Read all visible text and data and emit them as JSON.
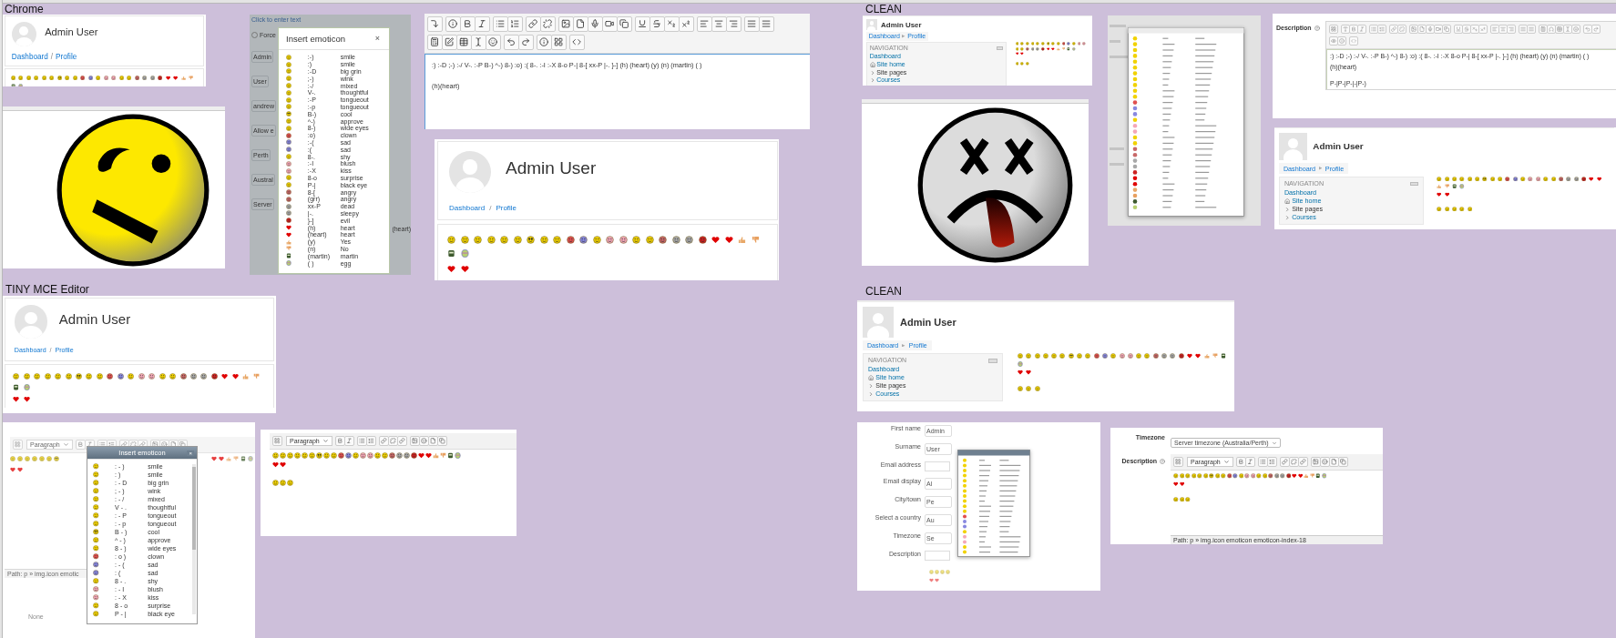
{
  "sections": [
    {
      "label": "Chrome"
    },
    {
      "label": "CLEAN"
    },
    {
      "label": "TINY MCE Editor"
    },
    {
      "label": "CLEAN"
    }
  ],
  "chrome_profile_small": {
    "name": "Admin User",
    "crumbs": [
      "Dashboard",
      "Profile"
    ],
    "separator": "/"
  },
  "chrome_dialog_screen": {
    "link": "Click to enter text",
    "fields": [
      {
        "label": "Force",
        "kind": "radio",
        "checked": false
      },
      {
        "label": "Admin",
        "kind": "field"
      },
      {
        "label": "User",
        "kind": "field"
      },
      {
        "label": "andrew",
        "kind": "field"
      },
      {
        "label": "Allow e",
        "kind": "field"
      },
      {
        "label": "Perth",
        "kind": "field"
      },
      {
        "label": "Austral",
        "kind": "field"
      },
      {
        "label": "Server",
        "kind": "field"
      }
    ],
    "editor_tail": "(heart)",
    "dialog": {
      "kind": "atto",
      "title": "Insert emoticon",
      "close": "×",
      "rows": [
        {
          "code": ":-)",
          "name": "smile"
        },
        {
          "code": ":)",
          "name": "smile"
        },
        {
          "code": ":-D",
          "name": "big grin"
        },
        {
          "code": ";-)",
          "name": "wink"
        },
        {
          "code": ":-/",
          "name": "mixed"
        },
        {
          "code": "V-.",
          "name": "thoughtful"
        },
        {
          "code": ":-P",
          "name": "tongueout"
        },
        {
          "code": ":-p",
          "name": "tongueout"
        },
        {
          "code": "B-)",
          "name": "cool"
        },
        {
          "code": "^-)",
          "name": "approve"
        },
        {
          "code": "8-)",
          "name": "wide eyes"
        },
        {
          "code": ":o)",
          "name": "clown"
        },
        {
          "code": ":-(",
          "name": "sad"
        },
        {
          "code": ":(",
          "name": "sad"
        },
        {
          "code": "8-.",
          "name": "shy"
        },
        {
          "code": ":-I",
          "name": "blush"
        },
        {
          "code": ":-X",
          "name": "kiss"
        },
        {
          "code": "8-o",
          "name": "surprise"
        },
        {
          "code": "P-|",
          "name": "black eye"
        },
        {
          "code": "8-[",
          "name": "angry"
        },
        {
          "code": "(grr)",
          "name": "angry"
        },
        {
          "code": "xx-P",
          "name": "dead"
        },
        {
          "code": "|-.",
          "name": "sleepy"
        },
        {
          "code": "}-]",
          "name": "evil"
        },
        {
          "code": "(h)",
          "name": "heart"
        },
        {
          "code": "(heart)",
          "name": "heart"
        },
        {
          "code": "(y)",
          "name": "Yes"
        },
        {
          "code": "(n)",
          "name": "No"
        },
        {
          "code": "(martin)",
          "name": "martin"
        },
        {
          "code": "( )",
          "name": "egg"
        }
      ]
    }
  },
  "chrome_editor": {
    "lines": [
      ":) :-D ;-) :-/ V-. :-P B-) ^-) 8-) :o) :( 8-. :-I :-X 8-o P-| 8-[ xx-P |-. }-] (h) (heart) (y) (n) (martin) ( )",
      "(h)(heart)"
    ]
  },
  "chrome_profile_large": {
    "name": "Admin User",
    "crumbs": [
      "Dashboard",
      "Profile"
    ],
    "separator": "/"
  },
  "clean_profile_small": {
    "name": "Admin User",
    "crumbs": [
      "Dashboard",
      "Profile"
    ],
    "navigation": {
      "title": "NAVIGATION",
      "items": [
        {
          "label": "Dashboard",
          "kind": "link"
        },
        {
          "label": "Site home",
          "kind": "home"
        },
        {
          "label": "Site pages",
          "kind": "branch"
        },
        {
          "label": "Courses",
          "kind": "branch-link"
        }
      ]
    }
  },
  "clean_editor": {
    "label": "Description",
    "lines": [
      ":) :-D ;-) :-/ V-. :-P B-) ^-) 8-) :o) :( 8-. :-I :-X 8-o P-| 8-[ xx-P |-. }-] (h) (heart) (y) (n) (martin) ( )",
      "(h)(heart)",
      "P-|P-|P-|-|P-)"
    ]
  },
  "clean_profile_medium": {
    "name": "Admin User",
    "crumbs": [
      "Dashboard",
      "Profile"
    ],
    "navigation": {
      "title": "NAVIGATION",
      "items": [
        {
          "label": "Dashboard",
          "kind": "link"
        },
        {
          "label": "Site home",
          "kind": "home"
        },
        {
          "label": "Site pages",
          "kind": "branch"
        },
        {
          "label": "Courses",
          "kind": "branch-link"
        }
      ]
    }
  },
  "tiny_profile": {
    "name": "Admin User",
    "crumbs": [
      "Dashboard",
      "Profile"
    ],
    "separator": "/"
  },
  "tiny_dialog_screen": {
    "format": "Paragraph",
    "path": "Path: p » img.icon emotic",
    "none": "None",
    "dialog": {
      "kind": "tiny",
      "title": "Insert emoticon",
      "close": "×",
      "rows": [
        {
          "code": ": - )",
          "name": "smile"
        },
        {
          "code": ": )",
          "name": "smile"
        },
        {
          "code": ": - D",
          "name": "big grin"
        },
        {
          "code": "; - )",
          "name": "wink"
        },
        {
          "code": ": - /",
          "name": "mixed"
        },
        {
          "code": "V - .",
          "name": "thoughtful"
        },
        {
          "code": ": - P",
          "name": "tongueout"
        },
        {
          "code": ": - p",
          "name": "tongueout"
        },
        {
          "code": "B - )",
          "name": "cool"
        },
        {
          "code": "^ - )",
          "name": "approve"
        },
        {
          "code": "8 - )",
          "name": "wide eyes"
        },
        {
          "code": ": o )",
          "name": "clown"
        },
        {
          "code": ": - (",
          "name": "sad"
        },
        {
          "code": ": (",
          "name": "sad"
        },
        {
          "code": "8 - .",
          "name": "shy"
        },
        {
          "code": ": - I",
          "name": "blush"
        },
        {
          "code": ": - X",
          "name": "kiss"
        },
        {
          "code": "8 - o",
          "name": "surprise"
        },
        {
          "code": "P - |",
          "name": "black eye"
        }
      ]
    }
  },
  "tiny_editor": {
    "format": "Paragraph"
  },
  "clean_profile_large": {
    "name": "Admin User",
    "crumbs": [
      "Dashboard",
      "Profile"
    ],
    "navigation": {
      "title": "NAVIGATION",
      "items": [
        {
          "label": "Dashboard",
          "kind": "link"
        },
        {
          "label": "Site home",
          "kind": "home"
        },
        {
          "label": "Site pages",
          "kind": "branch"
        },
        {
          "label": "Courses",
          "kind": "branch-link"
        }
      ]
    }
  },
  "clean_form_screen": {
    "fields": [
      {
        "label": "First name",
        "value": "Admin"
      },
      {
        "label": "Surname",
        "value": "User"
      },
      {
        "label": "Email address"
      },
      {
        "label": "Email display",
        "value": "Al"
      },
      {
        "label": "City/town",
        "value": "Pe"
      },
      {
        "label": "Select a country",
        "value": "Au"
      },
      {
        "label": "Timezone",
        "value": "Se"
      },
      {
        "label": "Description"
      }
    ]
  },
  "clean_tiny_editor": {
    "timezone_label": "Timezone",
    "timezone": "Server timezone (Australia/Perth)",
    "label": "Description",
    "format": "Paragraph",
    "path": "Path: p » img.icon emoticon emoticon-index-18"
  }
}
